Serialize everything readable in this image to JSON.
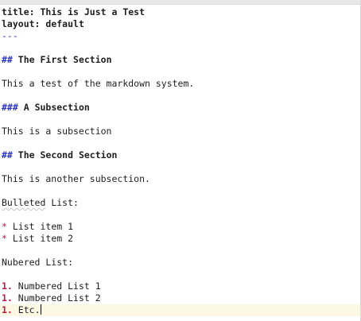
{
  "front_matter": {
    "title_key": "title:",
    "title_value": "This is Just a Test",
    "layout_key": "layout:",
    "layout_value": "default",
    "separator": "---"
  },
  "section1": {
    "mark": "##",
    "title": "The First Section",
    "body": "This a test of the markdown system."
  },
  "subsection": {
    "mark": "###",
    "title": "A Subsection",
    "body": "This is a subsection"
  },
  "section2": {
    "mark": "##",
    "title": "The Second Section",
    "body": "This is another subsection."
  },
  "bulleted": {
    "label_word": "Bulleted",
    "label_rest": " List:",
    "marker": "*",
    "items": [
      "List item 1",
      "List item 2"
    ]
  },
  "numbered": {
    "label": "Nubered List:",
    "marker": "1.",
    "items": [
      "Numbered List 1",
      "Numbered List 2",
      "Etc."
    ]
  },
  "colors": {
    "heading_mark": "#2b34c8",
    "list_marker": "#c8143c",
    "current_line": "#fdf8e3"
  }
}
